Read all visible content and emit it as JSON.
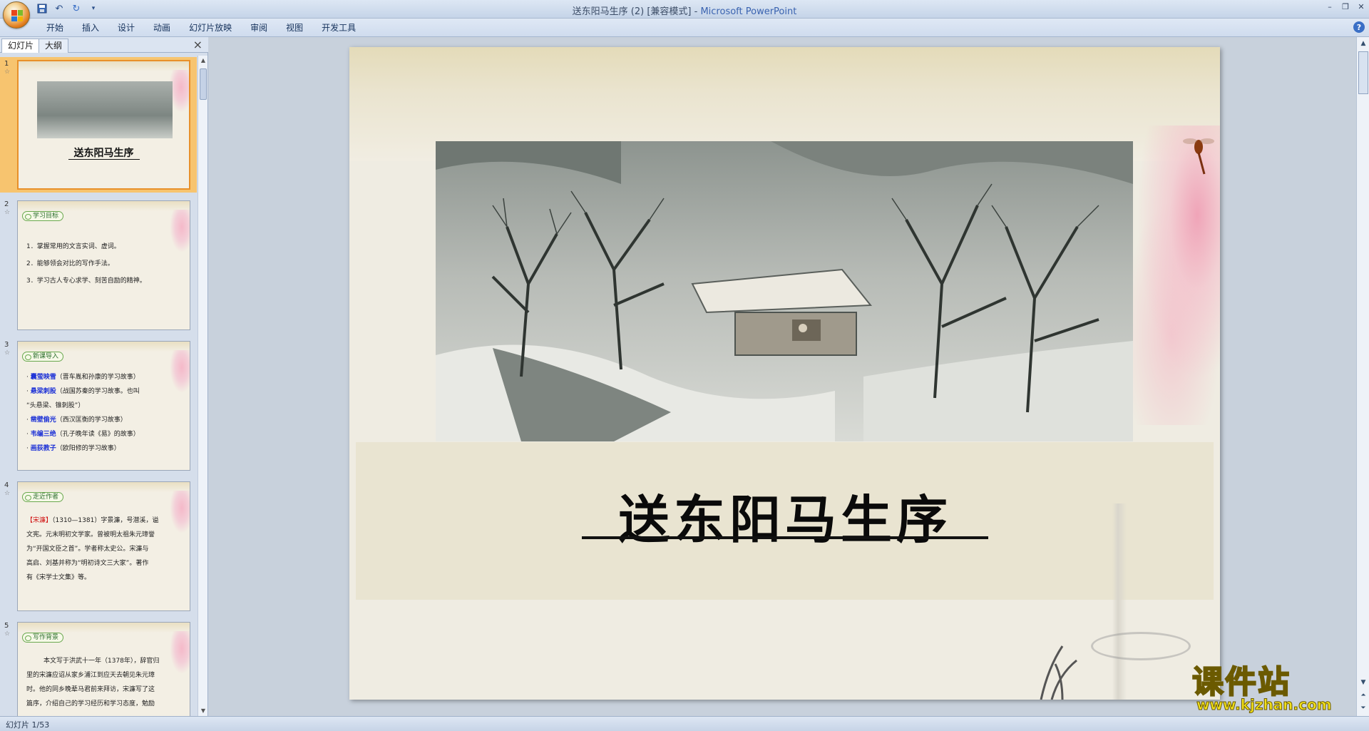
{
  "window": {
    "title_doc": "送东阳马生序 (2) [兼容模式] - ",
    "title_app": "Microsoft PowerPoint"
  },
  "quick_access": {
    "save_icon": "save-icon",
    "undo_icon": "undo-icon",
    "redo_icon": "redo-icon",
    "customize_icon": "chevron-down-icon"
  },
  "ribbon": {
    "tabs": [
      "开始",
      "插入",
      "设计",
      "动画",
      "幻灯片放映",
      "审阅",
      "视图",
      "开发工具"
    ],
    "help": "?"
  },
  "left_pane": {
    "tab_slides": "幻灯片",
    "tab_outline": "大纲",
    "close": "×"
  },
  "thumbnails": [
    {
      "number": "1",
      "title": "送东阳马生序"
    },
    {
      "number": "2",
      "badge": "学习目标",
      "lines": [
        "1．掌握常用的文言实词、虚词。",
        "2．能够领会对比的写作手法。",
        "3．学习古人专心求学、刻苦自励的精神。"
      ]
    },
    {
      "number": "3",
      "badge": "新课导入",
      "items": [
        {
          "key": "囊萤映雪",
          "rest": "（晋车胤和孙康的学习故事）"
        },
        {
          "key": "悬梁刺股",
          "rest": "（战国苏秦的学习故事。也叫"
        },
        {
          "key": "",
          "rest": "“头悬梁、锥刺股”）"
        },
        {
          "key": "凿壁偷光",
          "rest": "（西汉匡衡的学习故事）"
        },
        {
          "key": "韦编三绝",
          "rest": "（孔子晚年读《易》的故事）"
        },
        {
          "key": "画荻教子",
          "rest": "（欧阳修的学习故事）"
        }
      ]
    },
    {
      "number": "4",
      "badge": "走近作者",
      "author": "【宋濂】",
      "lines": [
        "（1310—1381）字景濂，号潜溪，谥",
        "文宪。元末明初文学家。曾被明太祖朱元璋誉",
        "为“开国文臣之首”。学者称太史公。宋濂与",
        "高启、刘基并称为“明初诗文三大家”。著作",
        "有《宋学士文集》等。"
      ]
    },
    {
      "number": "5",
      "badge": "写作背景",
      "lines": [
        "本文写于洪武十一年（1378年），辞官归",
        "里的宋濂应诏从家乡浦江到应天去朝见朱元璋",
        "时。他的同乡晚辈马君前来拜访，宋濂写了这",
        "篇序，介绍自己的学习经历和学习态度，勉励"
      ]
    }
  ],
  "slide": {
    "title": "送东阳马生序"
  },
  "status": {
    "text": "幻灯片 1/53"
  },
  "watermark": {
    "cn": "课件站",
    "url": "www.kjzhan.com"
  }
}
